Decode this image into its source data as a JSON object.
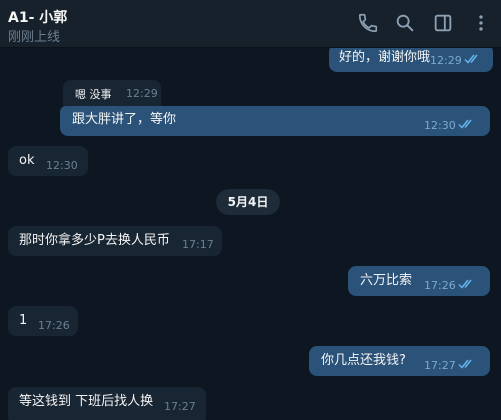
{
  "header": {
    "title": "A1- 小郭",
    "status": "刚刚上线",
    "icons": [
      "phone-icon",
      "search-icon",
      "sidebar-toggle-icon",
      "more-vertical-icon"
    ]
  },
  "colors": {
    "background": "#0e1621",
    "header": "#17212b",
    "incoming_bubble": "#182533",
    "outgoing_bubble": "#2b5278",
    "read_check": "#64b5ef"
  },
  "messages": [
    {
      "id": "m1",
      "direction": "out",
      "text": "好的，谢谢你哦",
      "time": "12:29",
      "read": true
    },
    {
      "id": "m2",
      "direction": "out",
      "reply_to": {
        "text": "嗯  没事",
        "time": "12:29"
      },
      "text": "跟大胖讲了，等你",
      "time": "12:30",
      "read": true
    },
    {
      "id": "m3",
      "direction": "in",
      "text": "ok",
      "time": "12:30"
    },
    {
      "id": "m4",
      "direction": "in",
      "text": "那时你拿多少P去换人民币",
      "time": "17:17"
    },
    {
      "id": "m5",
      "direction": "out",
      "text": "六万比索",
      "time": "17:26",
      "read": true
    },
    {
      "id": "m6",
      "direction": "in",
      "text": "1",
      "time": "17:26"
    },
    {
      "id": "m7",
      "direction": "out",
      "text": "你几点还我钱?",
      "time": "17:27",
      "read": true
    },
    {
      "id": "m8",
      "direction": "in",
      "text": "等这钱到 下班后找人换",
      "time": "17:27"
    }
  ],
  "date_separator": "5月4日"
}
